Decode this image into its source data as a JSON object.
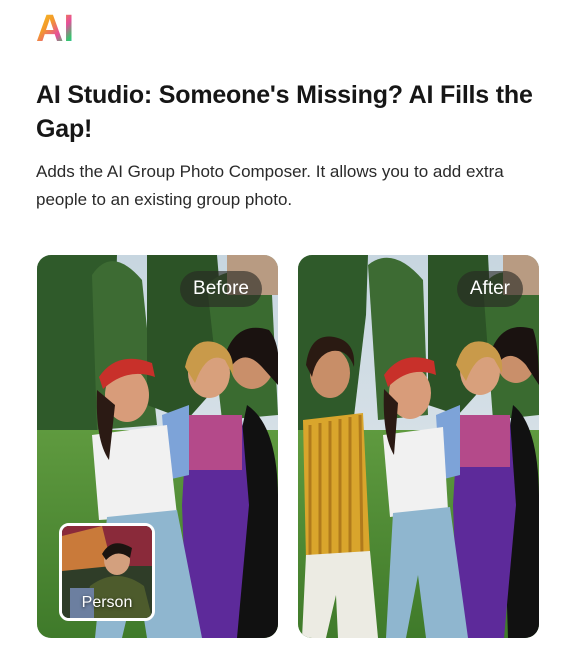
{
  "logo": {
    "text": "AI"
  },
  "headline": "AI Studio: Someone's Missing? AI Fills the Gap!",
  "description": "Adds the AI Group Photo Composer. It allows you to add extra people to an existing group photo.",
  "cards": {
    "before": {
      "badge": "Before",
      "thumbnail_label": "Person"
    },
    "after": {
      "badge": "After"
    }
  },
  "colors": {
    "badge_bg": "#28282499",
    "logo_gradient": [
      "#f7d21c",
      "#f39a2a",
      "#e64d9b",
      "#37c46c",
      "#2db8e6"
    ]
  }
}
